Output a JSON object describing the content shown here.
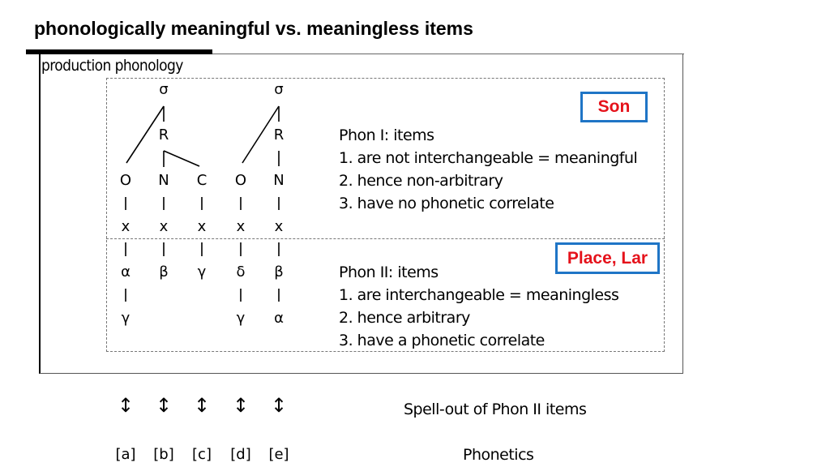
{
  "title": "phonologically meaningful vs. meaningless items",
  "section_label": "production phonology",
  "tree": {
    "syllable_symbol": "σ",
    "rime_symbol": "R",
    "segments": [
      {
        "constituent": "O",
        "skeleton": "x",
        "phon2": "α",
        "phon2b": "γ",
        "phonetic": "[a]"
      },
      {
        "constituent": "N",
        "skeleton": "x",
        "phon2": "β",
        "phon2b": "",
        "phonetic": "[b]"
      },
      {
        "constituent": "C",
        "skeleton": "x",
        "phon2": "γ",
        "phon2b": "",
        "phonetic": "[c]"
      },
      {
        "constituent": "O",
        "skeleton": "x",
        "phon2": "δ",
        "phon2b": "γ",
        "phonetic": "[d]"
      },
      {
        "constituent": "N",
        "skeleton": "x",
        "phon2": "β",
        "phon2b": "α",
        "phonetic": "[e]"
      }
    ],
    "spellout_arrow": "↕"
  },
  "phon1": {
    "tag": "Son",
    "heading": "Phon I: items",
    "points": [
      "1. are not interchangeable = meaningful",
      "2. hence non-arbitrary",
      "3. have no phonetic correlate"
    ]
  },
  "phon2": {
    "tag": "Place, Lar",
    "heading": "Phon II: items",
    "points": [
      "1. are interchangeable = meaningless",
      "2. hence arbitrary",
      "3. have a phonetic correlate"
    ]
  },
  "spellout_label": "Spell-out of Phon II items",
  "phonetics_label": "Phonetics",
  "colors": {
    "tag_border": "#1f75c6",
    "tag_text": "#e5121b"
  }
}
